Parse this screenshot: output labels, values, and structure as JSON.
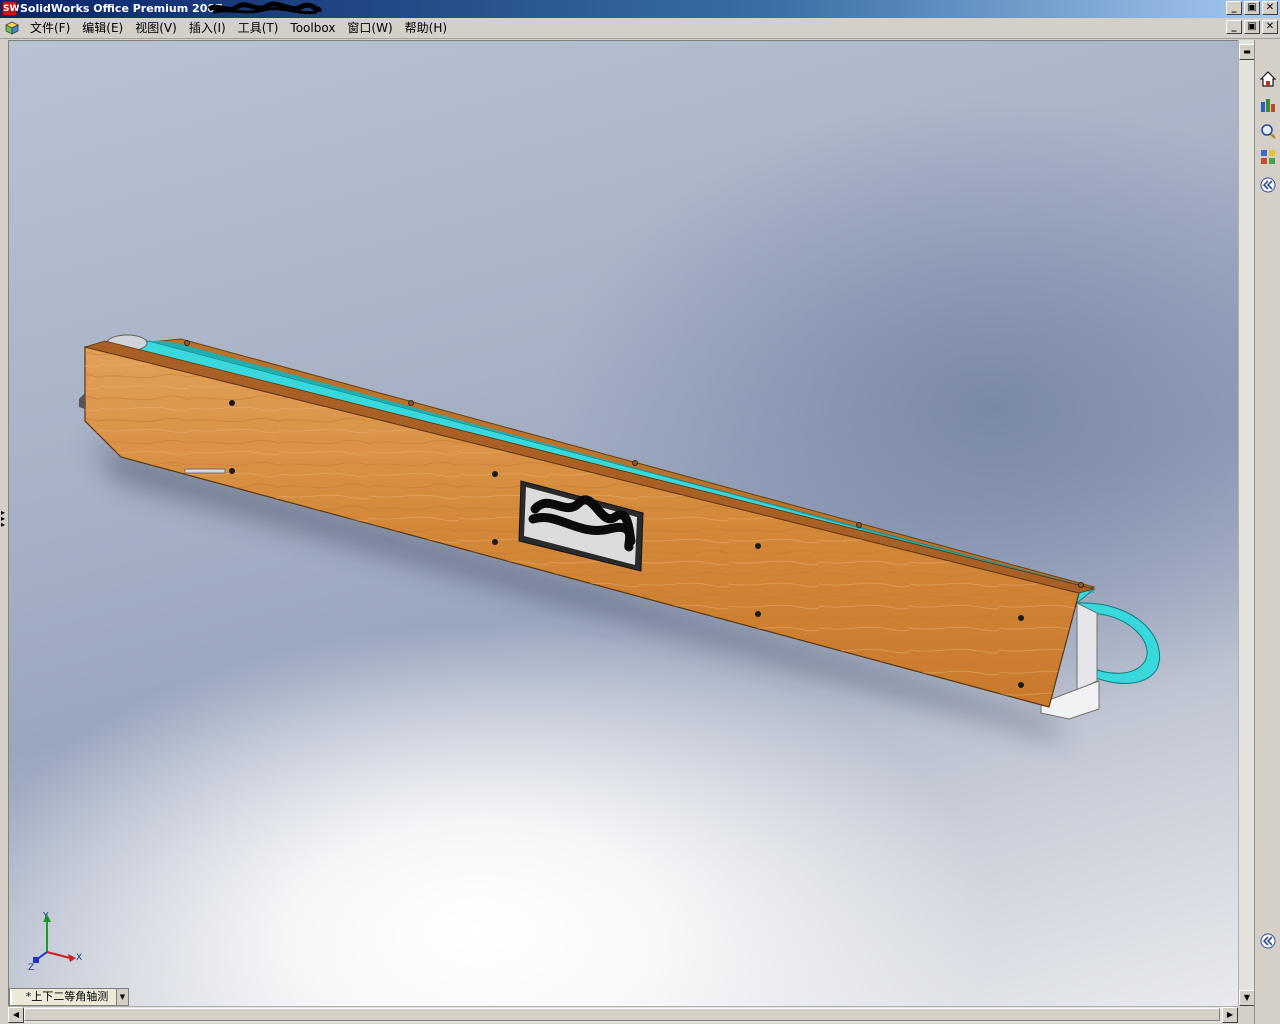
{
  "window": {
    "title": "SolidWorks Office Premium 2007 -",
    "logo_text": "SW",
    "title_buttons": [
      "_",
      "▣",
      "✕"
    ],
    "doc_buttons": [
      "_",
      "▣",
      "✕"
    ]
  },
  "menu": {
    "items": [
      {
        "label": "文件(F)"
      },
      {
        "label": "编辑(E)"
      },
      {
        "label": "视图(V)"
      },
      {
        "label": "插入(I)"
      },
      {
        "label": "工具(T)"
      },
      {
        "label": "Toolbox"
      },
      {
        "label": "窗口(W)"
      },
      {
        "label": "帮助(H)"
      }
    ]
  },
  "view": {
    "orientation_label": "*上下二等角轴测",
    "dropdown_arrow": "▼"
  },
  "triad": {
    "x_label": "X",
    "y_label": "Y",
    "z_label": "Z"
  },
  "task_pane": {
    "icons": [
      "home-icon",
      "resources-icon",
      "search-icon",
      "palette-icon",
      "collapse-icon"
    ]
  },
  "colors": {
    "wood": "#d58b3c",
    "belt": "#35d7db",
    "title_bar": "#0a246a"
  }
}
